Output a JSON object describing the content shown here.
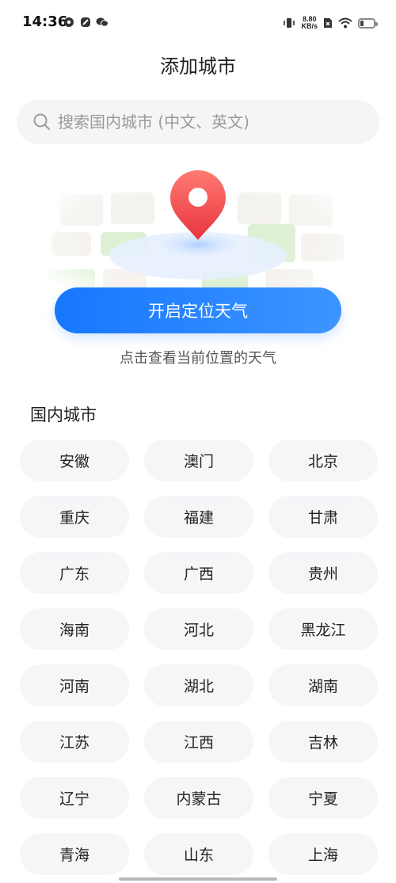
{
  "status_bar": {
    "time": "14:36",
    "net_speed_value": "8.80",
    "net_speed_unit": "KB/s",
    "battery_level": 0.22
  },
  "page": {
    "title": "添加城市"
  },
  "search": {
    "placeholder": "搜索国内城市 (中文、英文)"
  },
  "location": {
    "button_label": "开启定位天气",
    "hint": "点击查看当前位置的天气"
  },
  "domestic": {
    "title": "国内城市",
    "cities": [
      "安徽",
      "澳门",
      "北京",
      "重庆",
      "福建",
      "甘肃",
      "广东",
      "广西",
      "贵州",
      "海南",
      "河北",
      "黑龙江",
      "河南",
      "湖北",
      "湖南",
      "江苏",
      "江西",
      "吉林",
      "辽宁",
      "内蒙古",
      "宁夏",
      "青海",
      "山东",
      "上海"
    ]
  },
  "colors": {
    "accent_start": "#1677ff",
    "accent_end": "#3d95ff",
    "pin_red": "#f5474f"
  }
}
